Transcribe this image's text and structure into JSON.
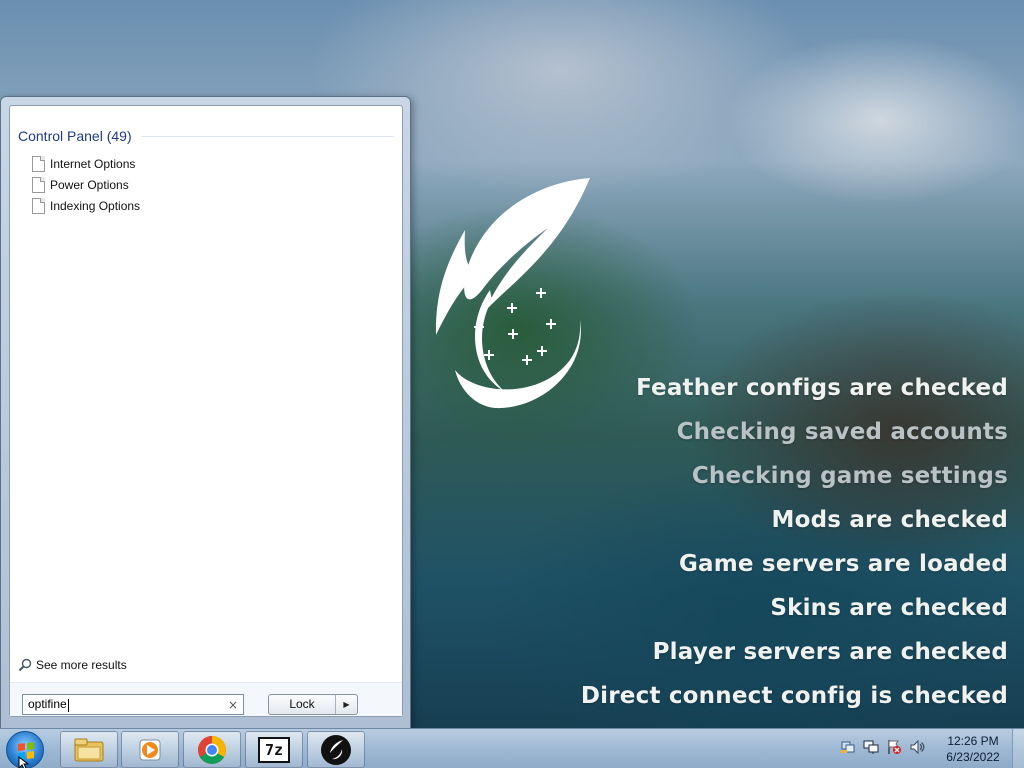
{
  "launcher": {
    "status_lines": [
      {
        "text": "Feather configs are checked",
        "color": "#f0f2f0"
      },
      {
        "text": "Checking saved accounts",
        "color": "#b9c2c4"
      },
      {
        "text": "Checking game settings",
        "color": "#b9c2c4"
      },
      {
        "text": "Mods are checked",
        "color": "#f0f2f0"
      },
      {
        "text": "Game servers are loaded",
        "color": "#f0f2f0"
      },
      {
        "text": "Skins are checked",
        "color": "#f0f2f0"
      },
      {
        "text": "Player servers are checked",
        "color": "#f0f2f0"
      },
      {
        "text": "Direct connect config is checked",
        "color": "#f0f2f0"
      }
    ],
    "logo_icon": "feather-logo-icon"
  },
  "start_menu": {
    "section_title": "Control Panel (49)",
    "results": [
      {
        "label": "Internet Options",
        "icon": "document-icon"
      },
      {
        "label": "Power Options",
        "icon": "document-icon"
      },
      {
        "label": "Indexing Options",
        "icon": "document-icon"
      }
    ],
    "see_more_label": "See more results",
    "search": {
      "value": "optifine",
      "clear_icon": "×"
    },
    "lock_button": {
      "label": "Lock",
      "arrow": "▶"
    }
  },
  "taskbar": {
    "start_icon": "windows-start-orb-icon",
    "pinned": [
      "explorer-icon",
      "media-player-icon",
      "chrome-icon",
      "7zip-icon",
      "feather-client-icon"
    ],
    "seven_zip_label": "7z",
    "tray_icons": [
      "network-icon",
      "monitor-icon",
      "action-center-icon",
      "volume-icon"
    ],
    "clock": {
      "time": "12:26 PM",
      "date": "6/23/2022"
    }
  },
  "colors": {
    "accent_title": "#1e3b87",
    "taskbar": "#a9c1da"
  }
}
